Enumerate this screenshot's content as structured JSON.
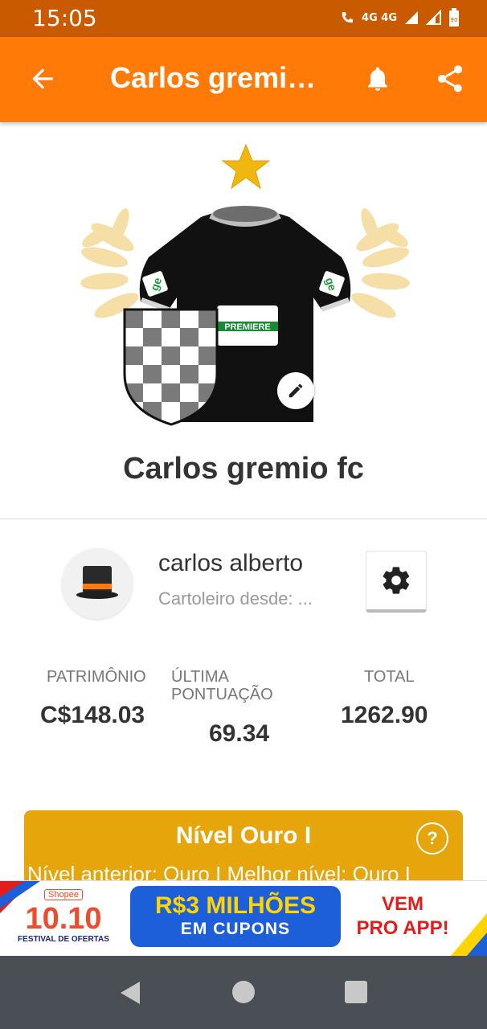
{
  "status_bar": {
    "time": "15:05",
    "network_label": "4G 4G",
    "battery": "90"
  },
  "app_bar": {
    "title": "Carlos gremio fc"
  },
  "team": {
    "name": "Carlos gremio fc",
    "sponsor_text": "PREMIERE",
    "sleeve_logo": "ge"
  },
  "user": {
    "name": "carlos alberto",
    "since_label": "Cartoleiro desde: ..."
  },
  "stats": [
    {
      "label": "PATRIMÔNIO",
      "value": "C$148.03"
    },
    {
      "label": "ÚLTIMA PONTUAÇÃO",
      "value": "69.34"
    },
    {
      "label": "TOTAL",
      "value": "1262.90"
    }
  ],
  "level": {
    "title": "Nível Ouro I",
    "subtitle": "Nível anterior: Ouro I Melhor nível: Ouro I",
    "help_label": "?"
  },
  "ad": {
    "brand_small": "Shopee",
    "brand_big": "10.10",
    "brand_sub": "FESTIVAL DE OFERTAS",
    "main_text": "R$3 MILHÕES",
    "main_sub": "EM CUPONS",
    "cta_line1": "VEM",
    "cta_line2": "PRO APP!"
  },
  "colors": {
    "status_bar": "#c95a00",
    "app_bar": "#ff7a07",
    "level_card": "#e6a50a",
    "nav_bar": "#4a4f55"
  },
  "icons": {
    "back": "arrow-left-icon",
    "bell": "bell-icon",
    "share": "share-icon",
    "edit": "pencil-icon",
    "settings": "gear-icon"
  }
}
